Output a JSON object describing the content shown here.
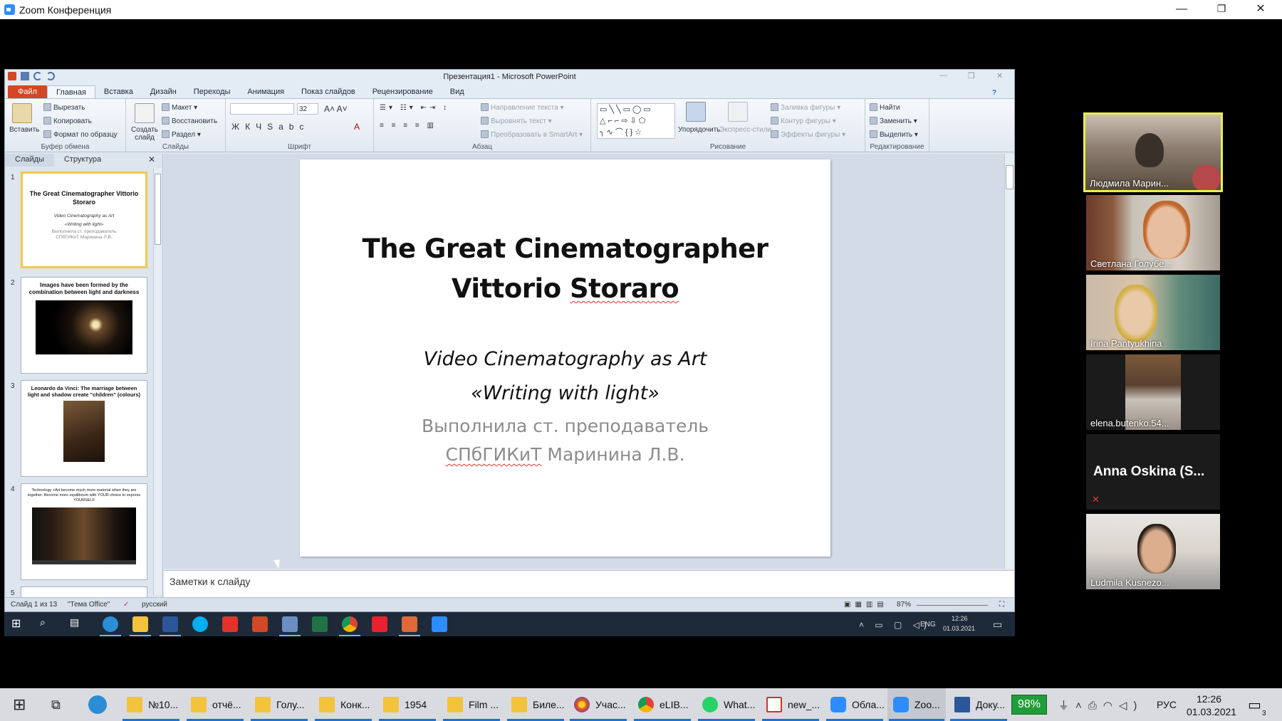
{
  "zoom": {
    "title": "Zoom Конференция",
    "controls": {
      "minimize": "—",
      "restore": "❐",
      "close": "✕"
    }
  },
  "ppt": {
    "window_title": "Презентация1  -  Microsoft PowerPoint",
    "tabs": [
      "Файл",
      "Главная",
      "Вставка",
      "Дизайн",
      "Переходы",
      "Анимация",
      "Показ слайдов",
      "Рецензирование",
      "Вид"
    ],
    "ribbon": {
      "clipboard": {
        "paste": "Вставить",
        "cut": "Вырезать",
        "copy": "Копировать",
        "format_painter": "Формат по образцу",
        "label": "Буфер обмена"
      },
      "slides": {
        "new_slide": "Создать слайд",
        "layout": "Макет",
        "reset": "Восстановить",
        "section": "Раздел",
        "label": "Слайды"
      },
      "font": {
        "size": "32",
        "label": "Шрифт"
      },
      "paragraph": {
        "text_direction": "Направление текста",
        "align_text": "Выровнять текст",
        "smartart": "Преобразовать в SmartArt",
        "label": "Абзац"
      },
      "drawing": {
        "arrange": "Упорядочить",
        "quick_styles": "Экспресс-стили",
        "fill": "Заливка фигуры",
        "outline": "Контур фигуры",
        "effects": "Эффекты фигуры",
        "label": "Рисование"
      },
      "editing": {
        "find": "Найти",
        "replace": "Заменить",
        "select": "Выделить",
        "label": "Редактирование"
      }
    },
    "panel_tabs": [
      "Слайды",
      "Структура"
    ],
    "thumbnails": [
      {
        "num": "1",
        "title": "The Great Cinematographer Vittorio Storaro",
        "sub1": "Video Cinematography as Art",
        "sub2": "«Writing with light»",
        "gray1": "Выполнила ст. преподаватель",
        "gray2": "СПбГИКиТ Маринина Л.В."
      },
      {
        "num": "2",
        "title": "Images have been formed by the combination between light and darkness"
      },
      {
        "num": "3",
        "title": "Leonardo  da Vinci: The marriage between light and shadow create \"children\" (colours)"
      },
      {
        "num": "4",
        "title": "Technology +Art become much more material when they are together. Become more equilibrium with YOUR choice to express YOURSELF"
      },
      {
        "num": "5"
      }
    ],
    "slide": {
      "title_line1": "The Great Cinematographer",
      "title_line2_a": "Vittorio ",
      "title_line2_b": "Storaro",
      "sub1": "Video Cinematography  as Art",
      "sub2": "«Writing with light»",
      "gray1": "Выполнила ст. преподаватель",
      "gray2_a": "СПбГИКиТ",
      "gray2_b": " Маринина Л.В."
    },
    "notes_placeholder": "Заметки к слайду",
    "status": {
      "slide": "Слайд 1 из 13",
      "theme": "\"Тема Office\"",
      "language": "русский",
      "zoom": "87%"
    }
  },
  "inner_taskbar": {
    "lang": "ENG",
    "time": "12:26",
    "date": "01.03.2021"
  },
  "participants": [
    {
      "name": "Людмила Марин..."
    },
    {
      "name": "Светлана Голубе..."
    },
    {
      "name": "Irina Pantyukhina"
    },
    {
      "name": "elena.butenko.54..."
    },
    {
      "name": "Anna Oskina (S..."
    },
    {
      "name": "Ludmila Kusnezo..."
    }
  ],
  "taskbar": {
    "items": [
      "№10...",
      "отчё...",
      "Голу...",
      "Конк...",
      "1954",
      "Film ...",
      "Биле...",
      "Учас...",
      "eLIB...",
      "What...",
      "new_...",
      "Обла...",
      "Zoo...",
      "Доку..."
    ],
    "battery": "98%",
    "lang": "РУС",
    "time": "12:26",
    "date": "01.03.2021",
    "notif_count": "3"
  }
}
